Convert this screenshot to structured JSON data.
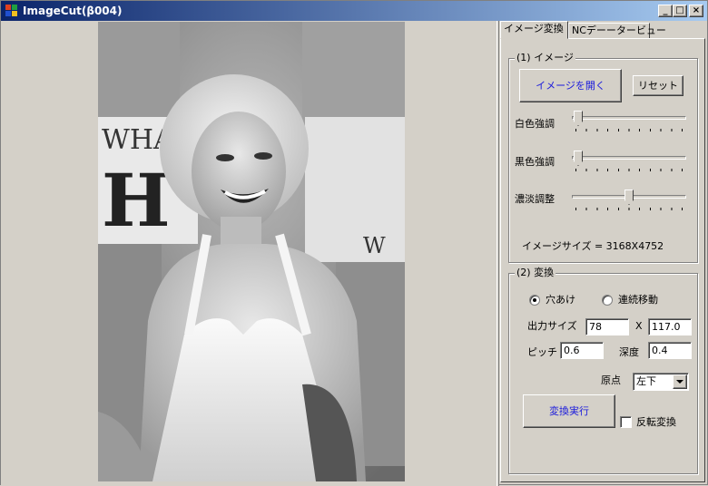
{
  "window": {
    "title": "ImageCut(β004)",
    "min_glyph": "_",
    "max_glyph": "□",
    "close_glyph": "×"
  },
  "tabs": [
    {
      "label": "イメージ変換",
      "selected": true
    },
    {
      "label": "NCデーータービュー",
      "selected": false
    }
  ],
  "image_group": {
    "title": "(1) イメージ",
    "open_button": "イメージを開く",
    "reset_button": "リセット",
    "sliders": [
      {
        "label": "白色強調",
        "value": 0.02
      },
      {
        "label": "黒色強調",
        "value": 0.02
      },
      {
        "label": "濃淡調整",
        "value": 0.5
      }
    ],
    "size_info": "イメージサイズ = 3168X4752"
  },
  "convert_group": {
    "title": "(2) 変換",
    "mode_hole": "穴あけ",
    "mode_continuous": "連続移動",
    "selected_mode": "hole",
    "output_size_label": "出力サイズ",
    "output_width": "78",
    "times_sign": "X",
    "output_height": "117.0",
    "pitch_label": "ピッチ",
    "pitch": "0.6",
    "depth_label": "深度",
    "depth": "0.4",
    "origin_label": "原点",
    "origin_value": "左下",
    "execute_button": "変換実行",
    "invert_label": "反転変換",
    "invert_checked": false
  },
  "photo": {
    "description_icon": "photo-image",
    "background_text_1": "WHA",
    "background_text_2": "H",
    "background_text_3": "W"
  },
  "colors": {
    "title_start": "#0a246a",
    "title_end": "#a6caf0",
    "face": "#d4d0c8",
    "button_text_blue": "#1a1adc"
  }
}
